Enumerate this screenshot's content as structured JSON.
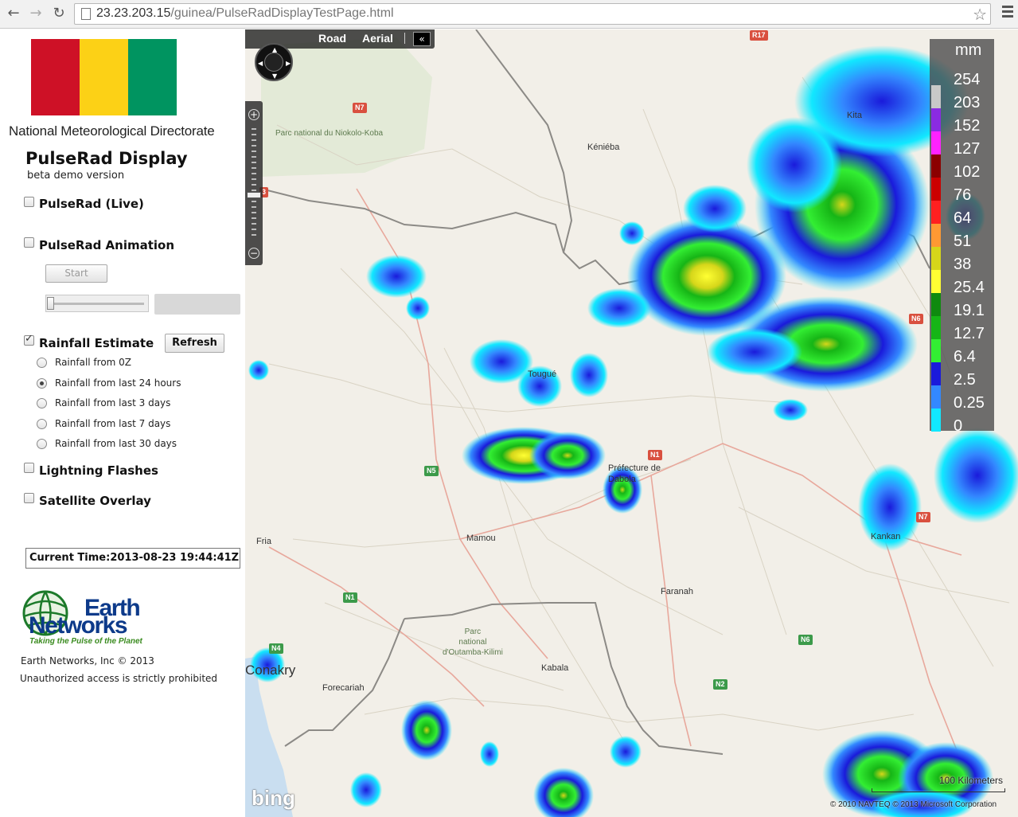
{
  "browser": {
    "url_host": "23.23.203.15",
    "url_path": "/guinea/PulseRadDisplayTestPage.html"
  },
  "sidebar": {
    "flag_colors": [
      "#ce1126",
      "#fcd116",
      "#009460"
    ],
    "organization": "National Meteorological Directorate",
    "app_title": "PulseRad Display",
    "app_subtitle": "beta demo version",
    "live_label": "PulseRad (Live)",
    "animation_label": "PulseRad Animation",
    "start_button": "Start",
    "rainfall_label": "Rainfall Estimate",
    "refresh_button": "Refresh",
    "rainfall_options": [
      {
        "label": "Rainfall from 0Z",
        "selected": false
      },
      {
        "label": "Rainfall from last 24 hours",
        "selected": true
      },
      {
        "label": "Rainfall from last 3 days",
        "selected": false
      },
      {
        "label": "Rainfall from last 7 days",
        "selected": false
      },
      {
        "label": "Rainfall from last 30 days",
        "selected": false
      }
    ],
    "lightning_label": "Lightning Flashes",
    "satellite_label": "Satellite Overlay",
    "current_time": "Current Time:2013-08-23 19:44:41Z",
    "logo_word1": "Earth",
    "logo_word2": "Networks",
    "logo_tagline": "Taking the Pulse of the Planet",
    "copyright": "Earth Networks, Inc © 2013",
    "notice": "Unauthorized access is strictly prohibited"
  },
  "map": {
    "tab_road": "Road",
    "tab_aerial": "Aerial",
    "collapse_icon": "«",
    "legend_unit": "mm",
    "legend": [
      {
        "value": "254",
        "color": "#c8c8c8"
      },
      {
        "value": "203",
        "color": "#8a2be2"
      },
      {
        "value": "152",
        "color": "#ff22ff"
      },
      {
        "value": "127",
        "color": "#8b0000"
      },
      {
        "value": "102",
        "color": "#cc0000"
      },
      {
        "value": "76",
        "color": "#ff2020"
      },
      {
        "value": "64",
        "color": "#ff9933"
      },
      {
        "value": "51",
        "color": "#d6d61a"
      },
      {
        "value": "38",
        "color": "#ffff33"
      },
      {
        "value": "25.4",
        "color": "#0f8a0f"
      },
      {
        "value": "19.1",
        "color": "#16b516"
      },
      {
        "value": "12.7",
        "color": "#33ee33"
      },
      {
        "value": "6.4",
        "color": "#1a1adb"
      },
      {
        "value": "2.5",
        "color": "#3388ff"
      },
      {
        "value": "0.25",
        "color": "#11e8ff"
      },
      {
        "value": "0",
        "color": "#ffffff"
      }
    ],
    "places": {
      "park_niokolo": "Parc national du Niokolo-Koba",
      "kenieba": "Kéniéba",
      "kita": "Kita",
      "tougue": "Tougué",
      "prefecture_dabola": "Préfecture de",
      "dabola": "Dabola",
      "mamou": "Mamou",
      "fria": "Fria",
      "kankan": "Kankan",
      "faranah": "Faranah",
      "park_outamba": "Parc\nnational\nd'Outamba-Kilimi",
      "kabala": "Kabala",
      "conakry": "Conakry",
      "forecariah": "Forecariah"
    },
    "shields": {
      "n7a": "N7",
      "n7b": "N7",
      "n1a": "N1",
      "n1b": "N1",
      "n5": "N5",
      "n4": "N4",
      "n6a": "N6",
      "n6b": "N6",
      "n2": "N2",
      "r17": "R17",
      "n3": "3"
    },
    "bing": "bing",
    "scale": "100 Kilometers",
    "attribution": "© 2010 NAVTEQ  © 2013 Microsoft Corporation"
  }
}
